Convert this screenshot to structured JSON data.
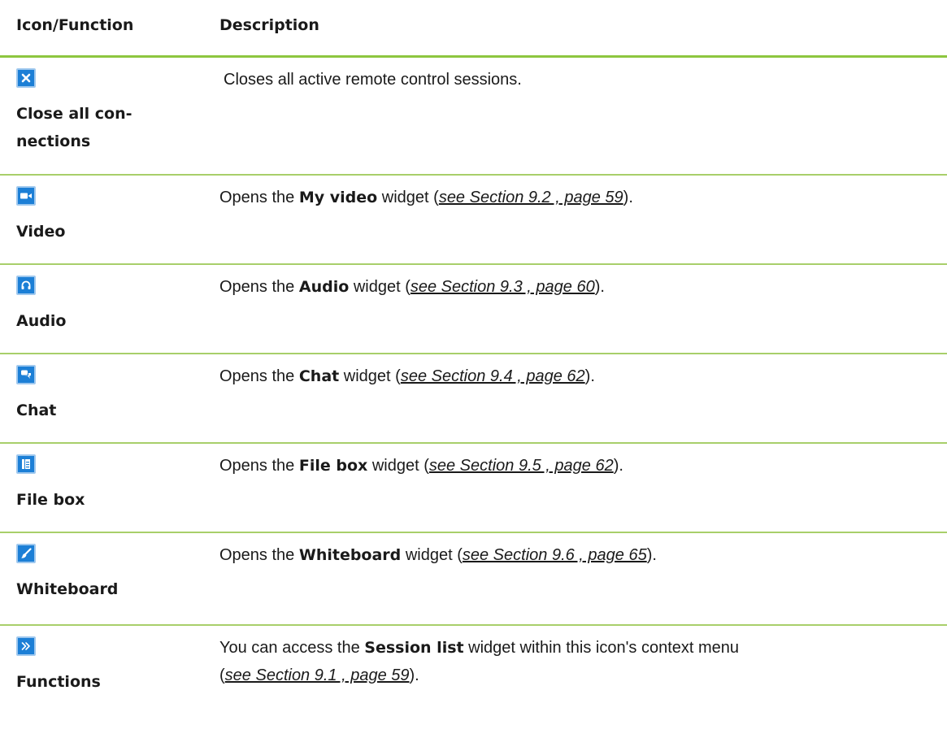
{
  "header": {
    "col_icon": "Icon/Function",
    "col_desc": "Description"
  },
  "rows": [
    {
      "icon": "close-icon",
      "name_line1": "Close all con-",
      "name_line2": "nections",
      "desc_text": "Closes all active remote control sessions."
    },
    {
      "icon": "video-camera-icon",
      "name": "Video",
      "desc_pre": "Opens the",
      "desc_bold": "My video",
      "desc_mid": "widget (",
      "desc_ref": "see Section 9.2 , page 59",
      "desc_post": ")."
    },
    {
      "icon": "headset-icon",
      "name": "Audio",
      "desc_pre": "Opens the",
      "desc_bold": "Audio",
      "desc_mid": "widget (",
      "desc_ref": "see Section 9.3 , page 60",
      "desc_post": ")."
    },
    {
      "icon": "chat-bubbles-icon",
      "name": "Chat",
      "desc_pre": "Opens the",
      "desc_bold": "Chat",
      "desc_mid": "widget (",
      "desc_ref": "see Section 9.4 , page 62",
      "desc_post": ")."
    },
    {
      "icon": "file-box-icon",
      "name": "File box",
      "desc_pre": "Opens the",
      "desc_bold": "File box",
      "desc_mid": "widget (",
      "desc_ref": "see Section 9.5 , page 62",
      "desc_post": ")."
    },
    {
      "icon": "brush-icon",
      "name": "Whiteboard",
      "desc_pre": "Opens the",
      "desc_bold": "Whiteboard",
      "desc_mid": "widget (",
      "desc_ref": "see Section 9.6 , page 65",
      "desc_post": ")."
    },
    {
      "icon": "double-chevron-right-icon",
      "name": "Functions",
      "desc_pre": "You can access the",
      "desc_bold": "Session list",
      "desc_mid": "widget within this icon's context menu",
      "desc_open": "(",
      "desc_ref": "see Section 9.1 , page 59",
      "desc_post": ")."
    }
  ],
  "colors": {
    "accent_green": "#8dc63f",
    "row_divider": "#a8cf6a",
    "icon_blue": "#1c7fd6"
  }
}
